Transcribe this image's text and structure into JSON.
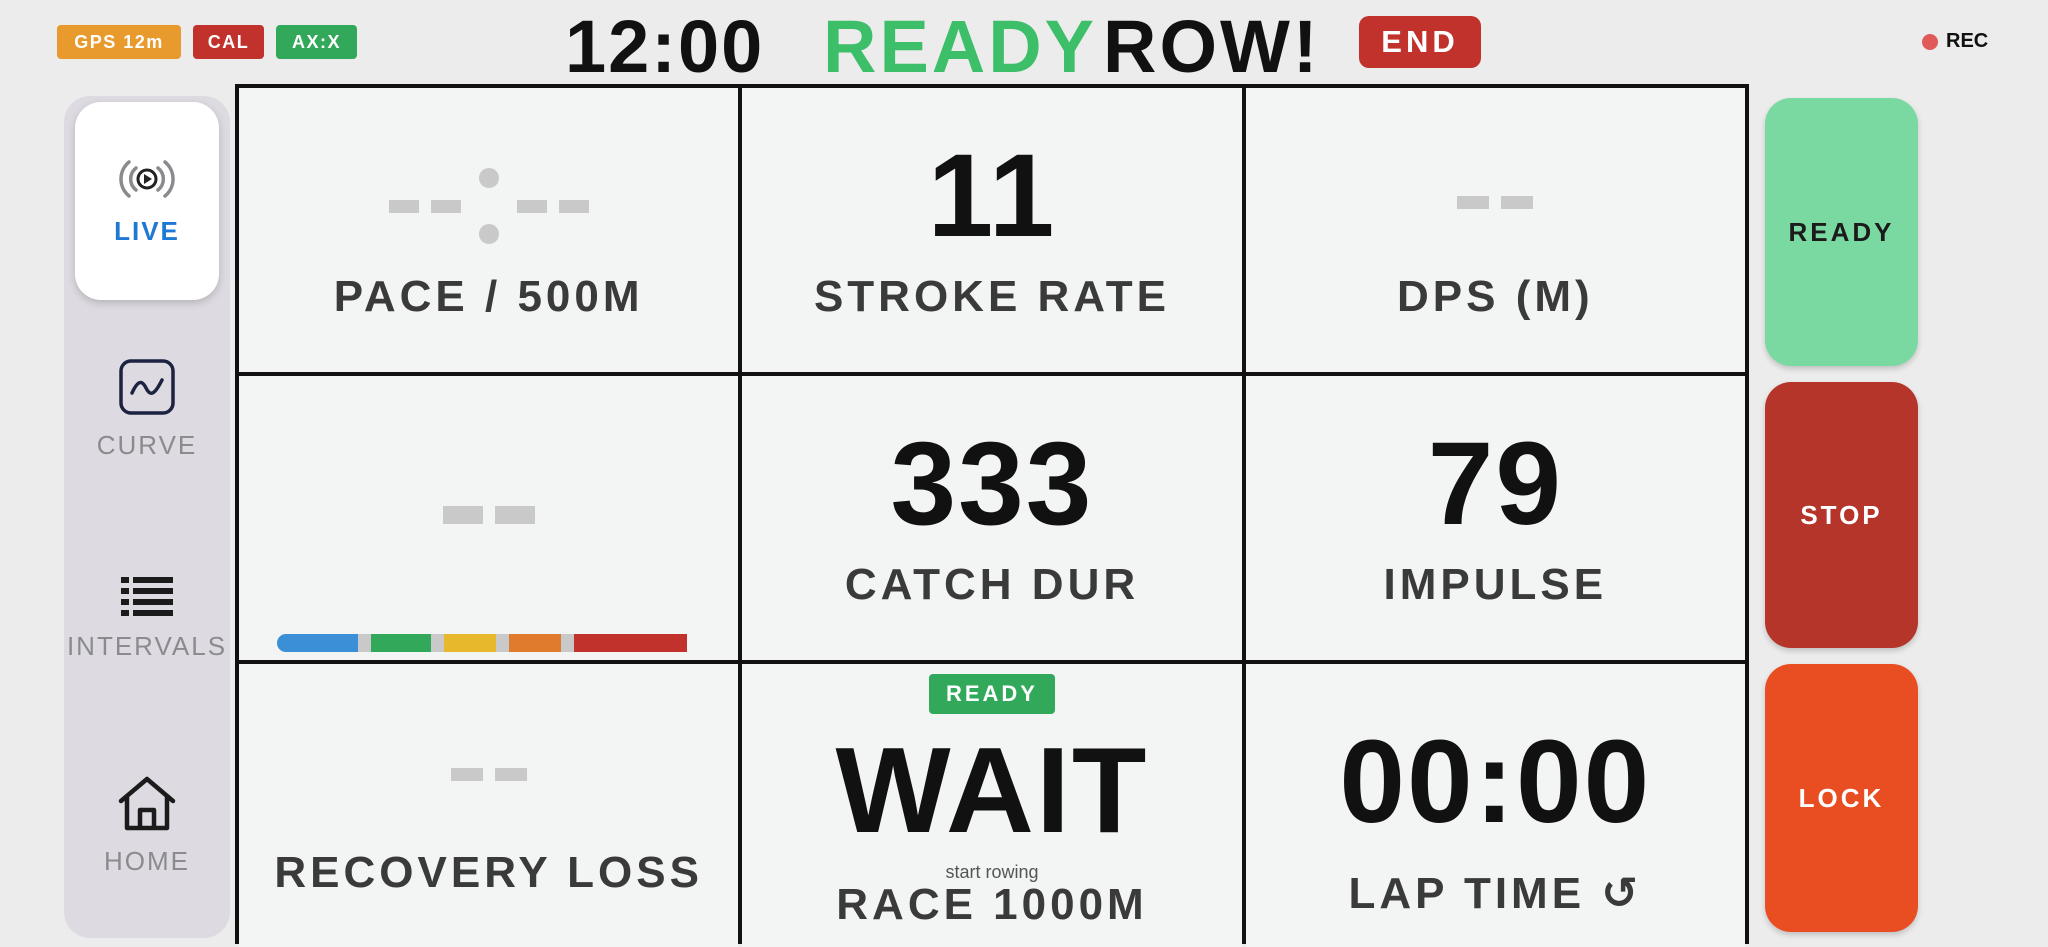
{
  "topbar": {
    "chips": [
      {
        "label": "GPS 12m",
        "color": "#e89a2c"
      },
      {
        "label": "CAL",
        "color": "#c0322b"
      },
      {
        "label": "AX:X",
        "color": "#32a85a"
      }
    ],
    "clock": "12:00",
    "status": "READY",
    "title": "ROW!",
    "end_label": "END",
    "rec_label": "REC"
  },
  "nav": {
    "items": [
      {
        "label": "LIVE",
        "icon": "live-broadcast-icon",
        "active": true
      },
      {
        "label": "CURVE",
        "icon": "curve-chart-icon",
        "active": false
      },
      {
        "label": "INTERVALS",
        "icon": "list-icon",
        "active": false
      },
      {
        "label": "HOME",
        "icon": "home-icon",
        "active": false
      }
    ]
  },
  "tiles": {
    "pace": {
      "value": "--:--",
      "label": "PACE / 500M"
    },
    "stroke_rate": {
      "value": "11",
      "label": "STROKE RATE"
    },
    "dps": {
      "value": "--",
      "label": "DPS (M)"
    },
    "zone": {
      "value": "--",
      "zone_colors": [
        "#3a8fd6",
        "#32a85a",
        "#e8b82c",
        "#e07a2c",
        "#c0322b"
      ]
    },
    "catch_dur": {
      "value": "333",
      "label": "CATCH DUR"
    },
    "impulse": {
      "value": "79",
      "label": "IMPULSE"
    },
    "recovery_loss": {
      "value": "--",
      "label": "RECOVERY LOSS"
    },
    "race": {
      "badge": "READY",
      "value": "WAIT",
      "hint": "start rowing",
      "label": "RACE 1000M"
    },
    "lap": {
      "value": "00:00",
      "label": "LAP TIME ↺",
      "reset_icon": "reset-icon"
    }
  },
  "controls": {
    "ready": {
      "label": "READY",
      "color": "#7ad9a0"
    },
    "stop": {
      "label": "STOP",
      "color": "#b5352b"
    },
    "lock": {
      "label": "LOCK",
      "color": "#e84e22"
    }
  }
}
